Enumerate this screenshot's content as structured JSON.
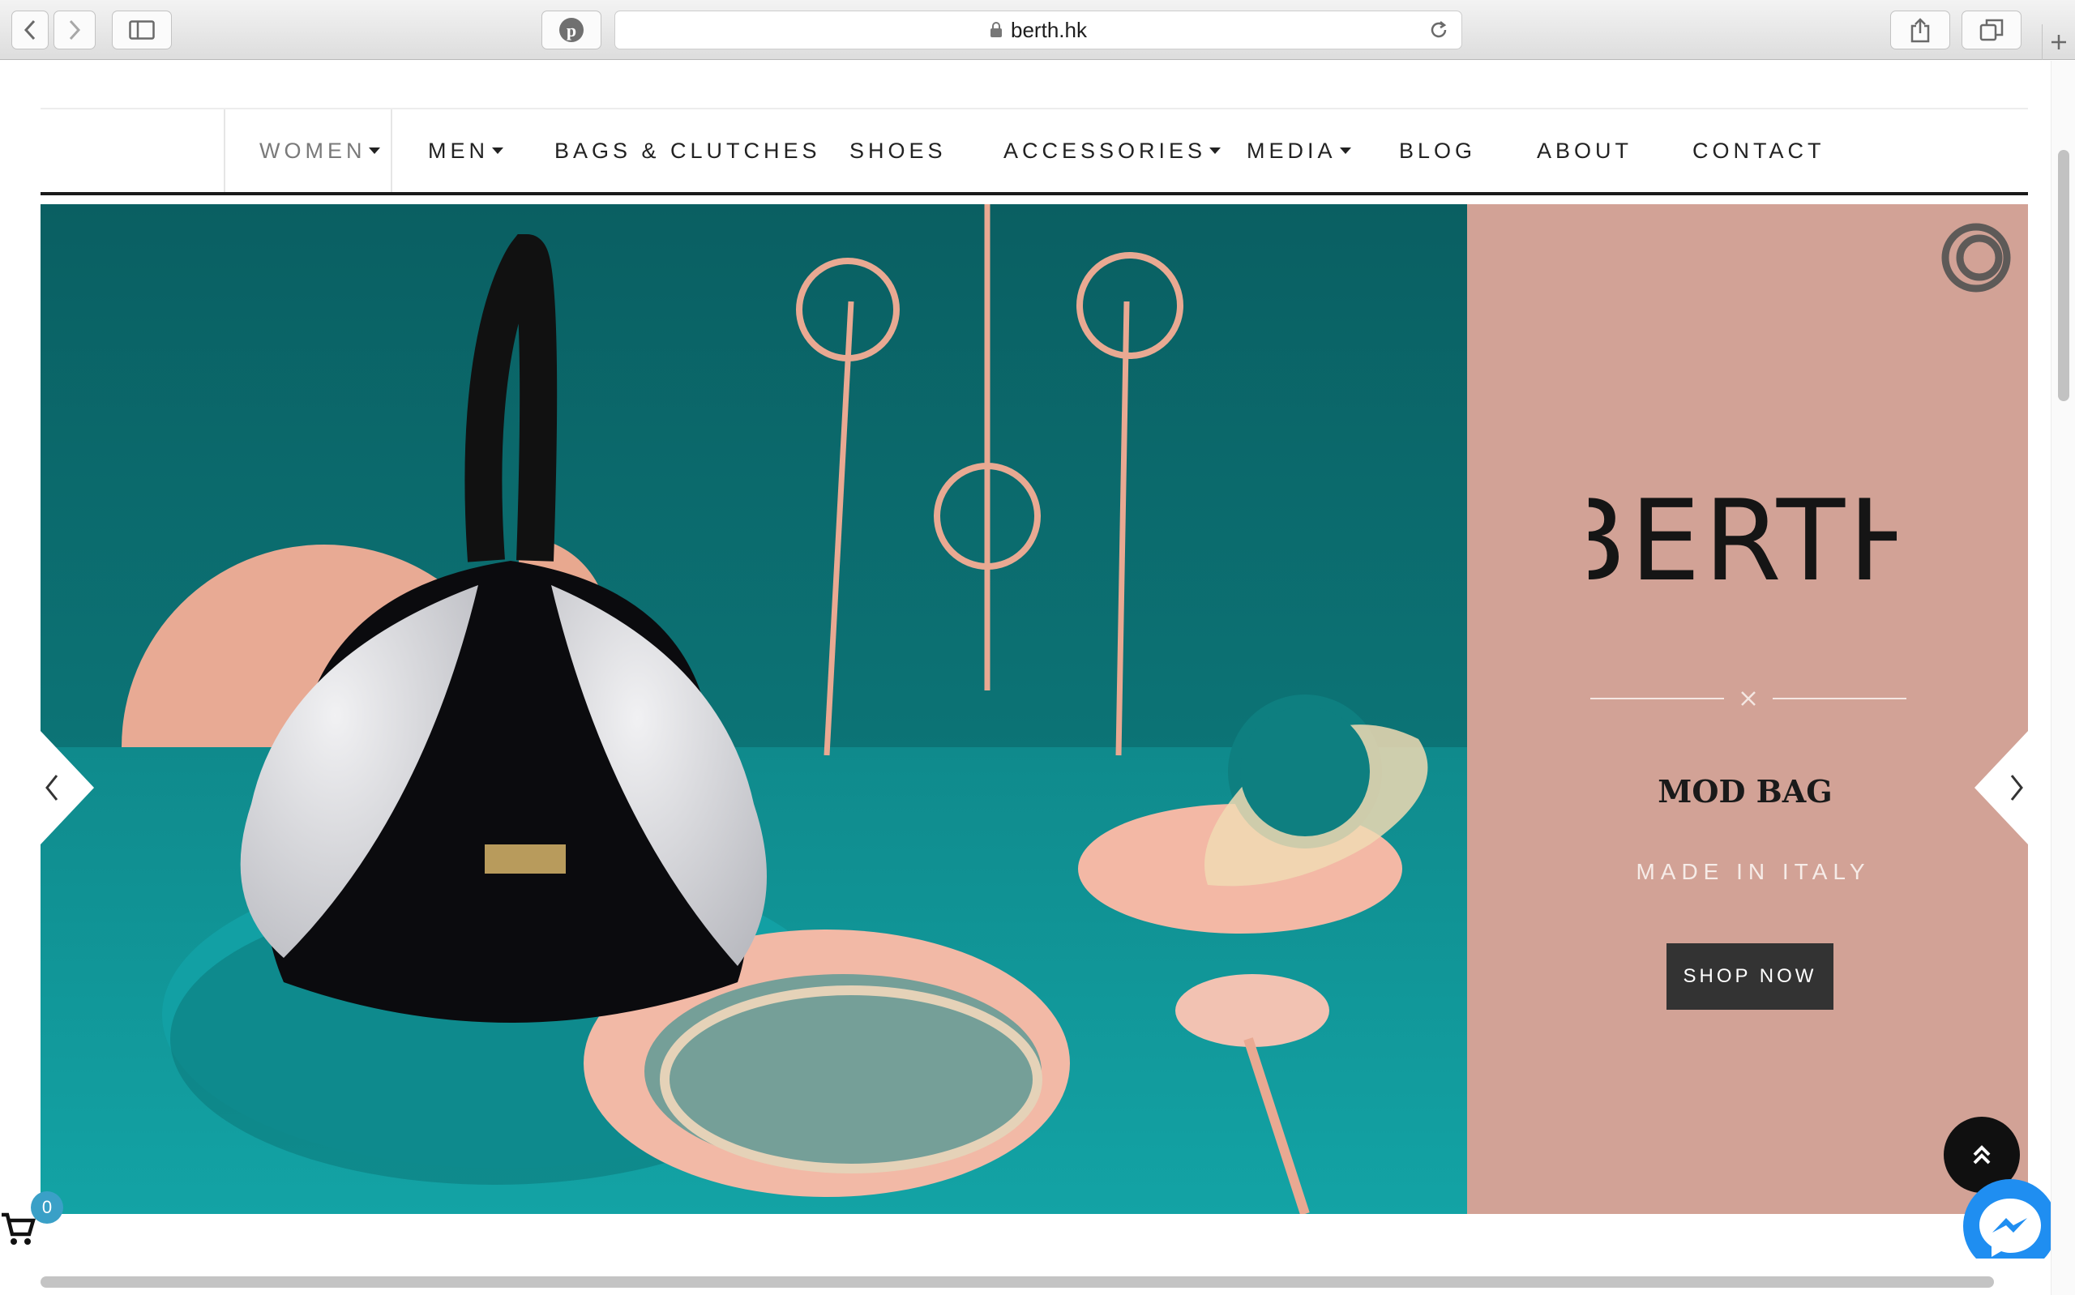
{
  "browser": {
    "url": "berth.hk",
    "buttons": [
      "back",
      "forward",
      "sidebar",
      "pinterest",
      "share",
      "tabs",
      "new-tab"
    ]
  },
  "nav": {
    "items": [
      {
        "label": "WOMEN",
        "dropdown": true,
        "active": true
      },
      {
        "label": "MEN",
        "dropdown": true
      },
      {
        "label": "BAGS & CLUTCHES",
        "dropdown": false
      },
      {
        "label": "SHOES",
        "dropdown": false
      },
      {
        "label": "ACCESSORIES",
        "dropdown": true
      },
      {
        "label": "MEDIA",
        "dropdown": true
      },
      {
        "label": "BLOG",
        "dropdown": false
      },
      {
        "label": "ABOUT",
        "dropdown": false
      },
      {
        "label": "CONTACT",
        "dropdown": false
      }
    ]
  },
  "hero": {
    "brand": "BERTH",
    "title": "MOD BAG",
    "subtitle": "MADE IN ITALY",
    "cta": "SHOP NOW",
    "panel_color": "#d2a296",
    "scene_color": "#0e7f80"
  },
  "cart": {
    "count": "0"
  },
  "colors": {
    "accent": "#3aa0c7",
    "button": "#333333",
    "messenger": "#1f8ef1"
  }
}
